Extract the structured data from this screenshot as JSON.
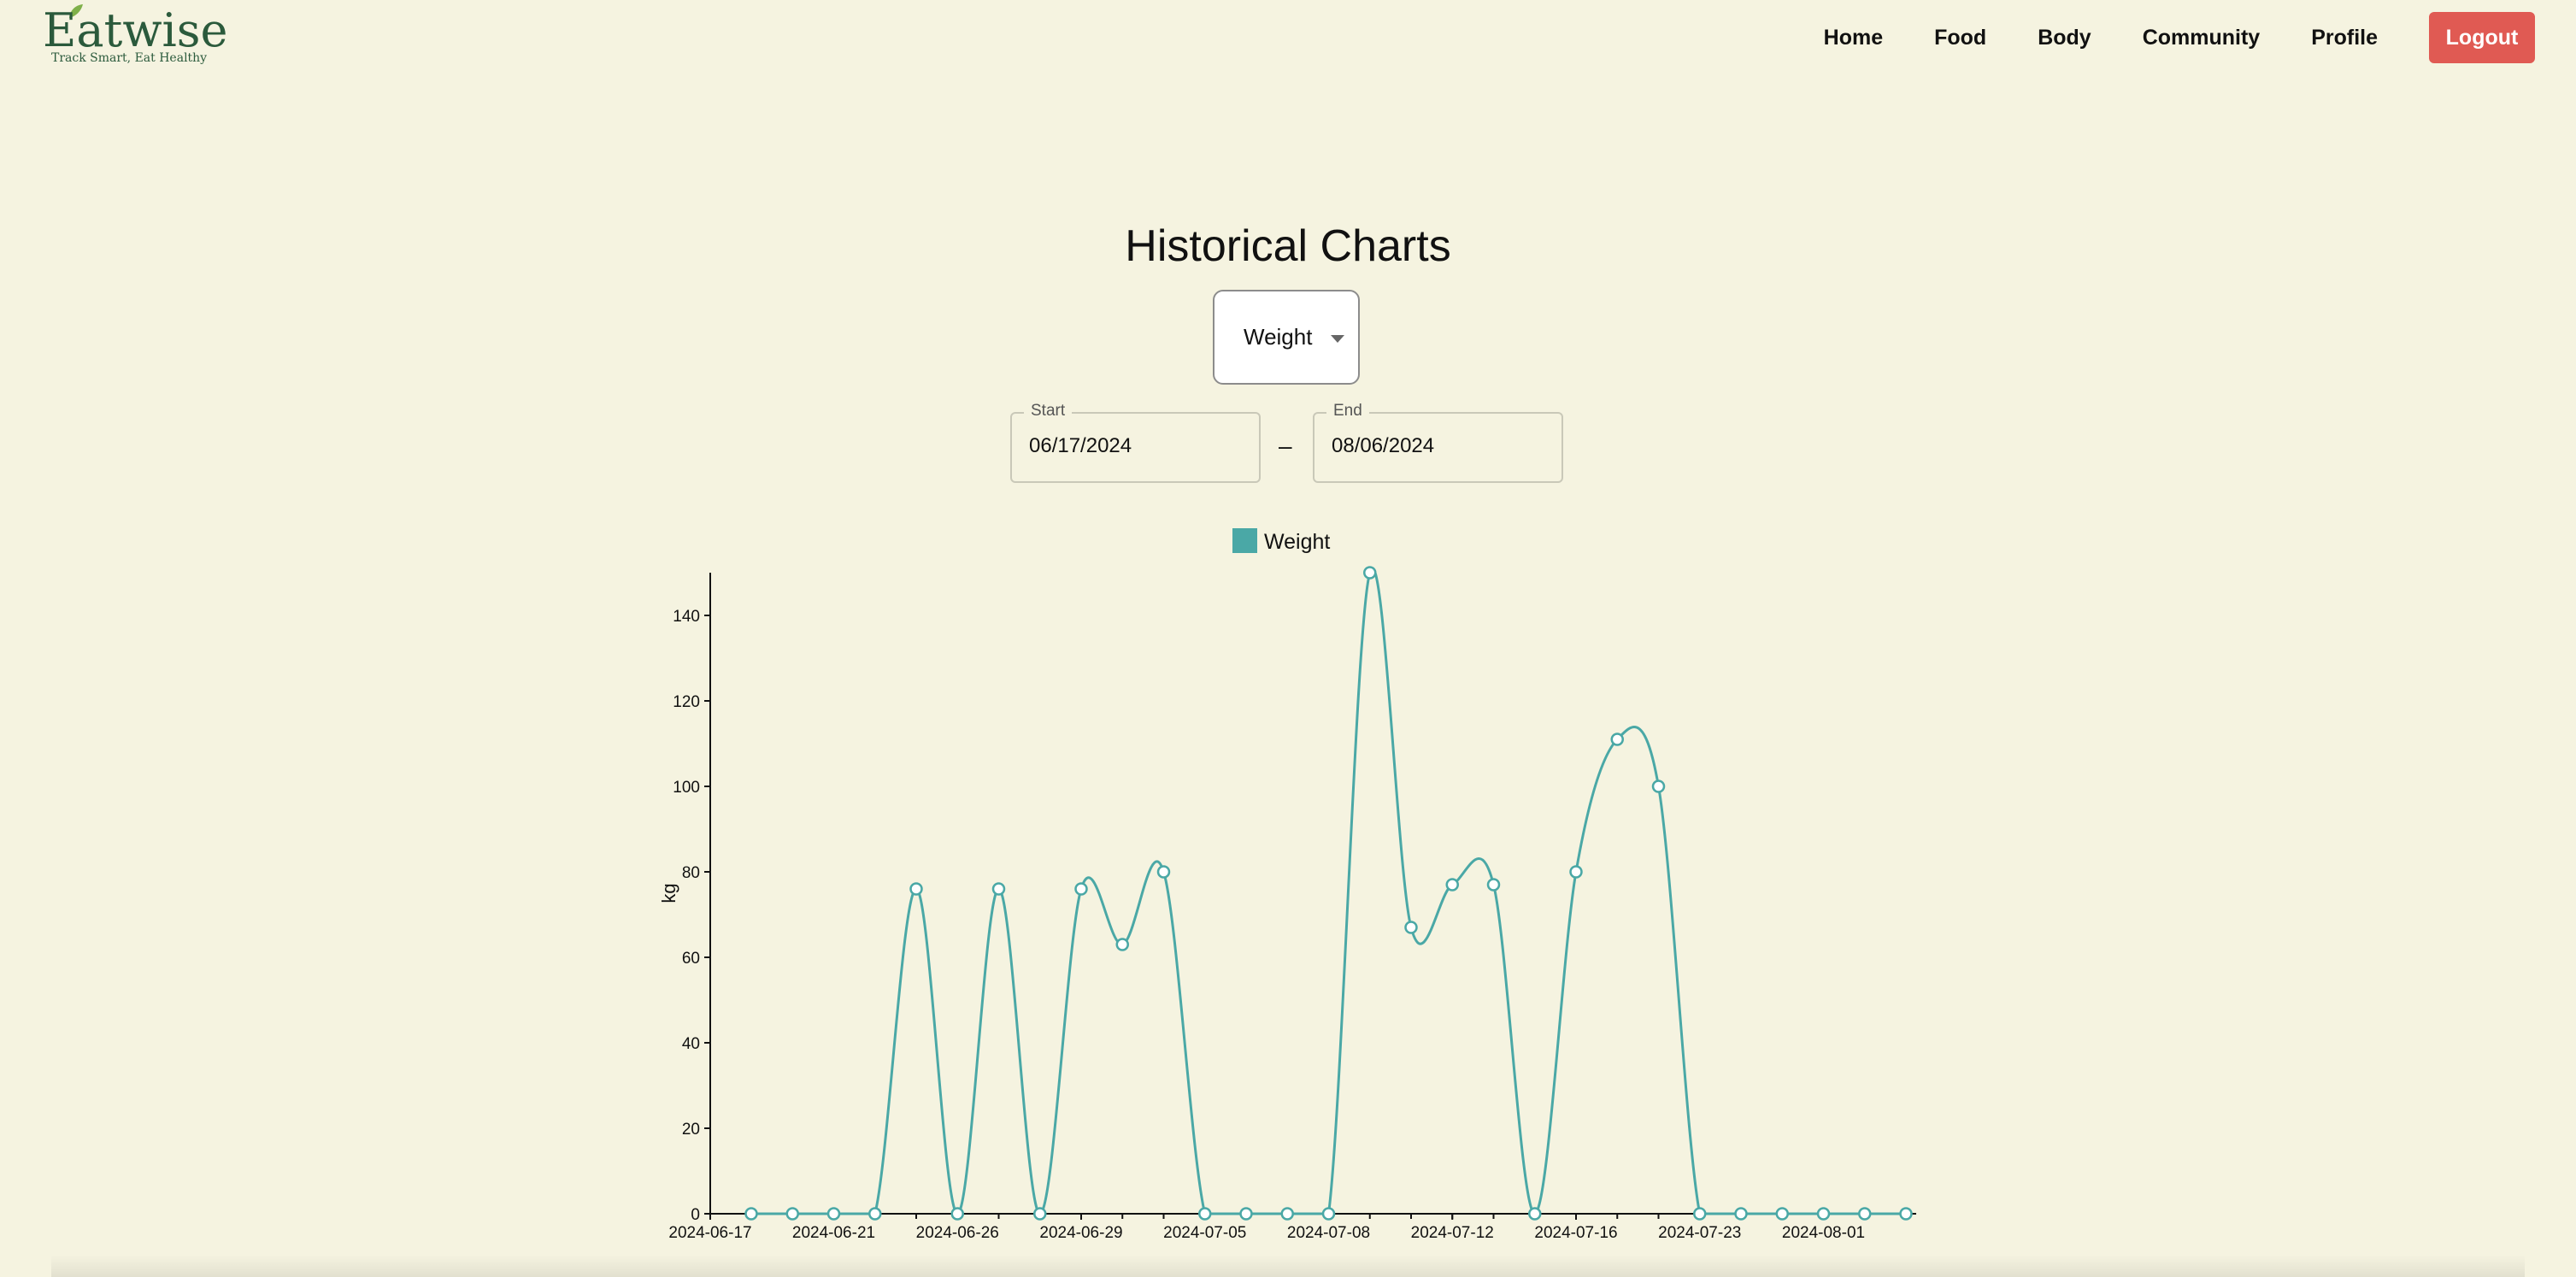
{
  "header": {
    "logo_text": "Eatwise",
    "tagline": "Track Smart, Eat Healthy",
    "nav": [
      "Home",
      "Food",
      "Body",
      "Community",
      "Profile"
    ],
    "logout_label": "Logout"
  },
  "page": {
    "title": "Historical Charts"
  },
  "metric_select": {
    "value": "Weight"
  },
  "date_range": {
    "start_label": "Start",
    "start_value": "06/17/2024",
    "separator": "–",
    "end_label": "End",
    "end_value": "08/06/2024"
  },
  "colors": {
    "background": "#f5f3e0",
    "accent": "#4aa8a6",
    "logout": "#e05a53",
    "brand": "#2b5a3c"
  },
  "chart_data": {
    "type": "line",
    "legend": [
      "Weight"
    ],
    "ylabel": "kg",
    "xlabel": "",
    "ylim": [
      0,
      150
    ],
    "yticks": [
      0,
      20,
      40,
      60,
      80,
      100,
      120,
      140
    ],
    "xtick_labels": [
      "2024-06-17",
      "2024-06-21",
      "2024-06-26",
      "2024-06-29",
      "2024-07-05",
      "2024-07-08",
      "2024-07-12",
      "2024-07-16",
      "2024-07-23",
      "2024-08-01"
    ],
    "series": [
      {
        "name": "Weight",
        "values": [
          0,
          0,
          0,
          0,
          76,
          0,
          76,
          0,
          76,
          63,
          80,
          0,
          0,
          0,
          0,
          150,
          67,
          77,
          77,
          0,
          80,
          111,
          100,
          0,
          0,
          0,
          0,
          0,
          0
        ]
      }
    ]
  }
}
